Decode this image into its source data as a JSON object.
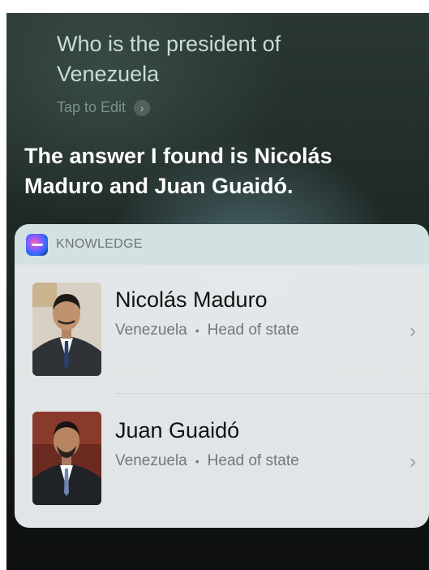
{
  "siri": {
    "query": "Who is the president of Venezuela",
    "tap_to_edit": "Tap to Edit",
    "answer": "The answer I found is Nicolás Maduro and Juan Guaidó."
  },
  "card": {
    "title": "KNOWLEDGE",
    "items": [
      {
        "name": "Nicolás Maduro",
        "country": "Venezuela",
        "role": "Head of state"
      },
      {
        "name": "Juan Guaidó",
        "country": "Venezuela",
        "role": "Head of state"
      }
    ]
  },
  "icons": {
    "tap_edit": "chevron-right-icon",
    "card_logo": "siri-icon",
    "row_chevron": "chevron-right-icon"
  }
}
